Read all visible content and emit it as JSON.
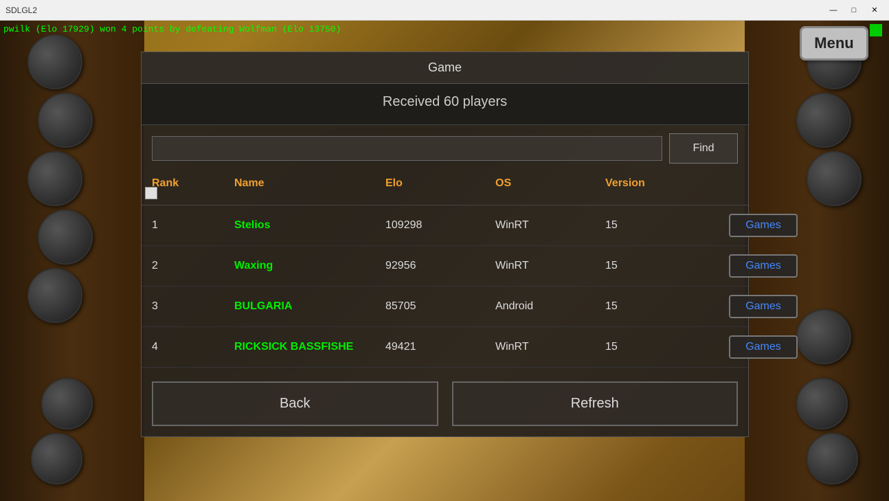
{
  "titlebar": {
    "title": "SDLGL2",
    "minimize": "—",
    "maximize": "□",
    "close": "✕"
  },
  "notification": {
    "text": "pwilk  (Elo 17929)  won 4 points by defeating Wolfman  (Elo 13750)"
  },
  "menu_button": {
    "label": "Menu"
  },
  "dialog": {
    "header": "Game",
    "received": "Received 60 players",
    "search_placeholder": "",
    "find_button": "Find",
    "columns": {
      "rank": "Rank",
      "name": "Name",
      "elo": "Elo",
      "os": "OS",
      "version": "Version"
    },
    "rows": [
      {
        "rank": "1",
        "name": "Stelios",
        "elo": "109298",
        "os": "WinRT",
        "version": "15",
        "games": "Games"
      },
      {
        "rank": "2",
        "name": "Waxing",
        "elo": "92956",
        "os": "WinRT",
        "version": "15",
        "games": "Games"
      },
      {
        "rank": "3",
        "name": "BULGARIA",
        "elo": "85705",
        "os": "Android",
        "version": "15",
        "games": "Games"
      },
      {
        "rank": "4",
        "name": "RICKSICK BASSFISHE",
        "elo": "49421",
        "os": "WinRT",
        "version": "15",
        "games": "Games"
      }
    ],
    "back_button": "Back",
    "refresh_button": "Refresh"
  }
}
